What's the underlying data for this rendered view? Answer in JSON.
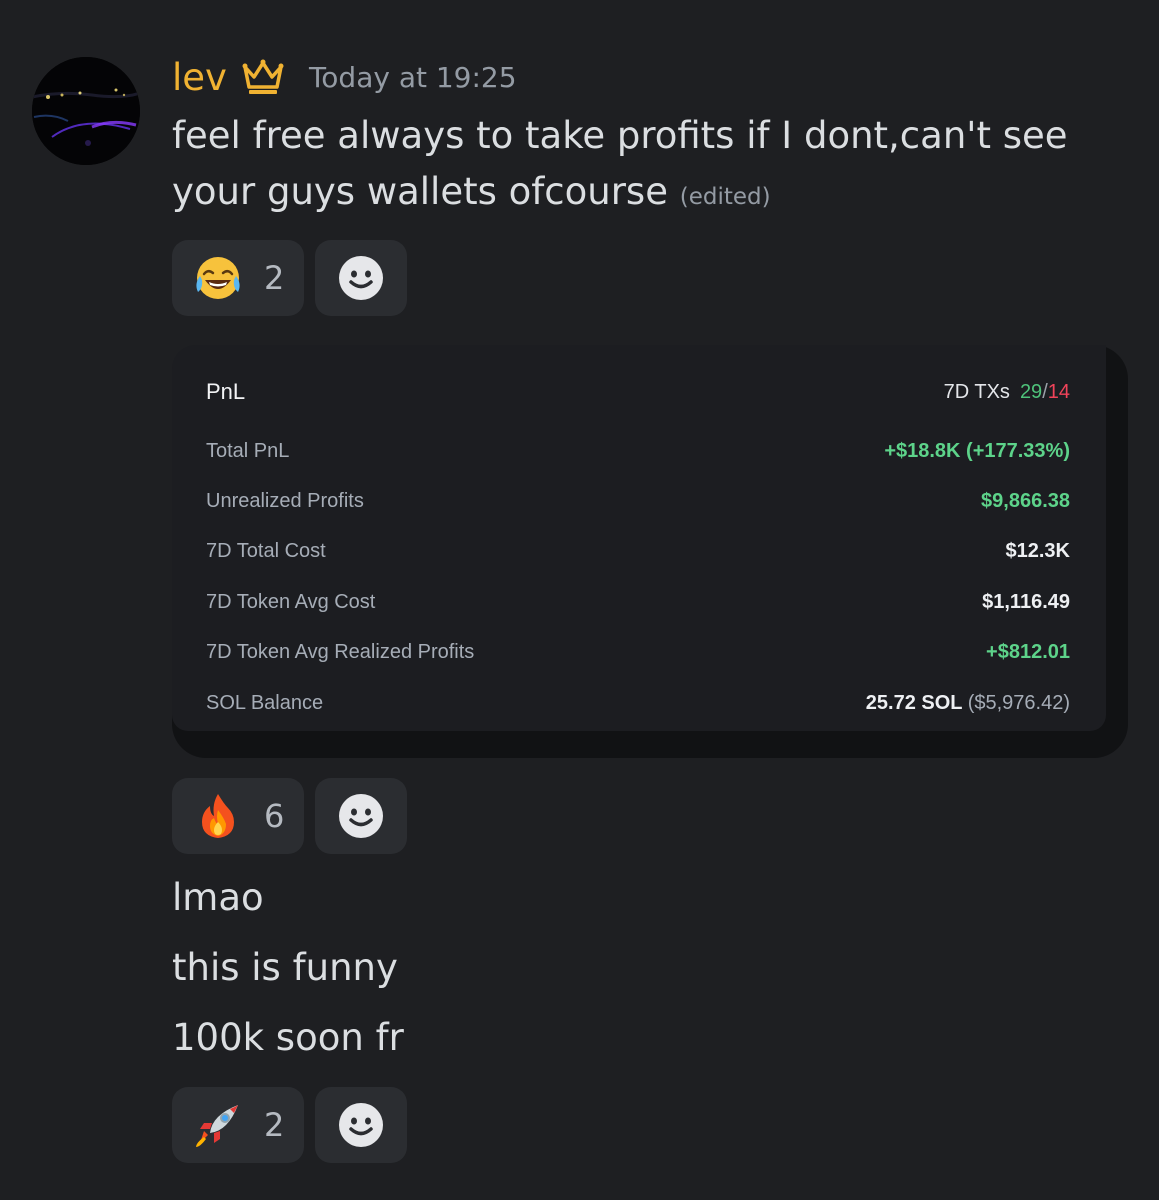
{
  "message": {
    "author": "lev",
    "author_badge_icon": "crown-icon",
    "timestamp": "Today at 19:25",
    "text": "feel free always to take profits if I dont,can't see your guys wallets ofcourse",
    "edited_label": "(edited)"
  },
  "reactions": {
    "first": {
      "emoji": "joy-emoji",
      "count": "2"
    },
    "second": {
      "emoji": "fire-emoji",
      "count": "6"
    },
    "third": {
      "emoji": "rocket-emoji",
      "count": "2"
    }
  },
  "pnl_card": {
    "title": "PnL",
    "txs_label": "7D TXs",
    "txs_buys": "29",
    "txs_sep": "/",
    "txs_sells": "14",
    "rows": [
      {
        "label": "Total PnL",
        "value": "+$18.8K (+177.33%)",
        "color": "#5dd38a"
      },
      {
        "label": "Unrealized Profits",
        "value": "$9,866.38",
        "color": "#5dd38a"
      },
      {
        "label": "7D Total Cost",
        "value": "$12.3K",
        "color": "#eef0f3"
      },
      {
        "label": "7D Token Avg Cost",
        "value": "$1,116.49",
        "color": "#eef0f3"
      },
      {
        "label": "7D Token Avg Realized Profits",
        "value": "+$812.01",
        "color": "#5dd38a"
      },
      {
        "label": "SOL Balance",
        "value": "25.72 SOL",
        "value_extra": "($5,976.42)",
        "color": "#eef0f3"
      }
    ]
  },
  "follow_up_lines": [
    "lmao",
    "this is funny",
    "100k soon fr"
  ],
  "colors": {
    "background": "#1e1f22",
    "username": "#f0b232",
    "timestamp": "#949ba4",
    "reaction_bg": "#2b2d31",
    "positive": "#5dd38a",
    "negative": "#f0435a"
  }
}
